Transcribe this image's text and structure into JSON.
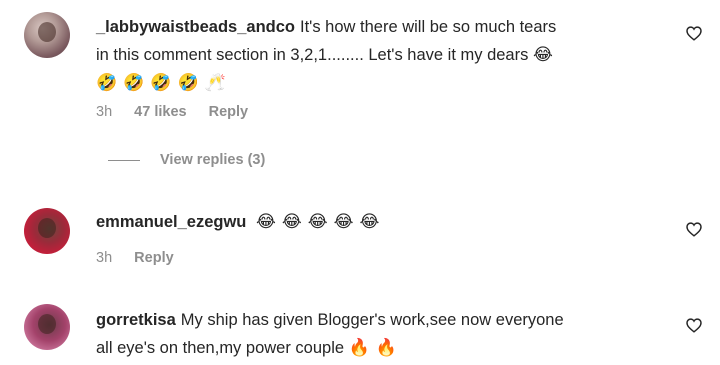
{
  "comments": [
    {
      "username": "_labbywaistbeads_andco",
      "text_line1": "It's how there will be so much tears",
      "text_line2": "in this comment section in 3,2,1........ Let's have it my dears",
      "emoji_line": [
        "😂"
      ],
      "emoji_row": [
        "🤣",
        "🤣",
        "🤣",
        "🤣",
        "🥂"
      ],
      "time": "3h",
      "likes": "47 likes",
      "reply": "Reply",
      "view_replies": "View replies (3)"
    },
    {
      "username": "emmanuel_ezegwu",
      "emojis": [
        "😂",
        "😂",
        "😂",
        "😂",
        "😂"
      ],
      "time": "3h",
      "reply": "Reply"
    },
    {
      "username": "gorretkisa",
      "text_line1": "My ship has given Blogger's work,see now everyone",
      "text_line2": "all eye's on then,my power couple",
      "emojis": [
        "🔥",
        "🔥"
      ]
    }
  ],
  "icons": {
    "like": "heart-outline-icon"
  }
}
